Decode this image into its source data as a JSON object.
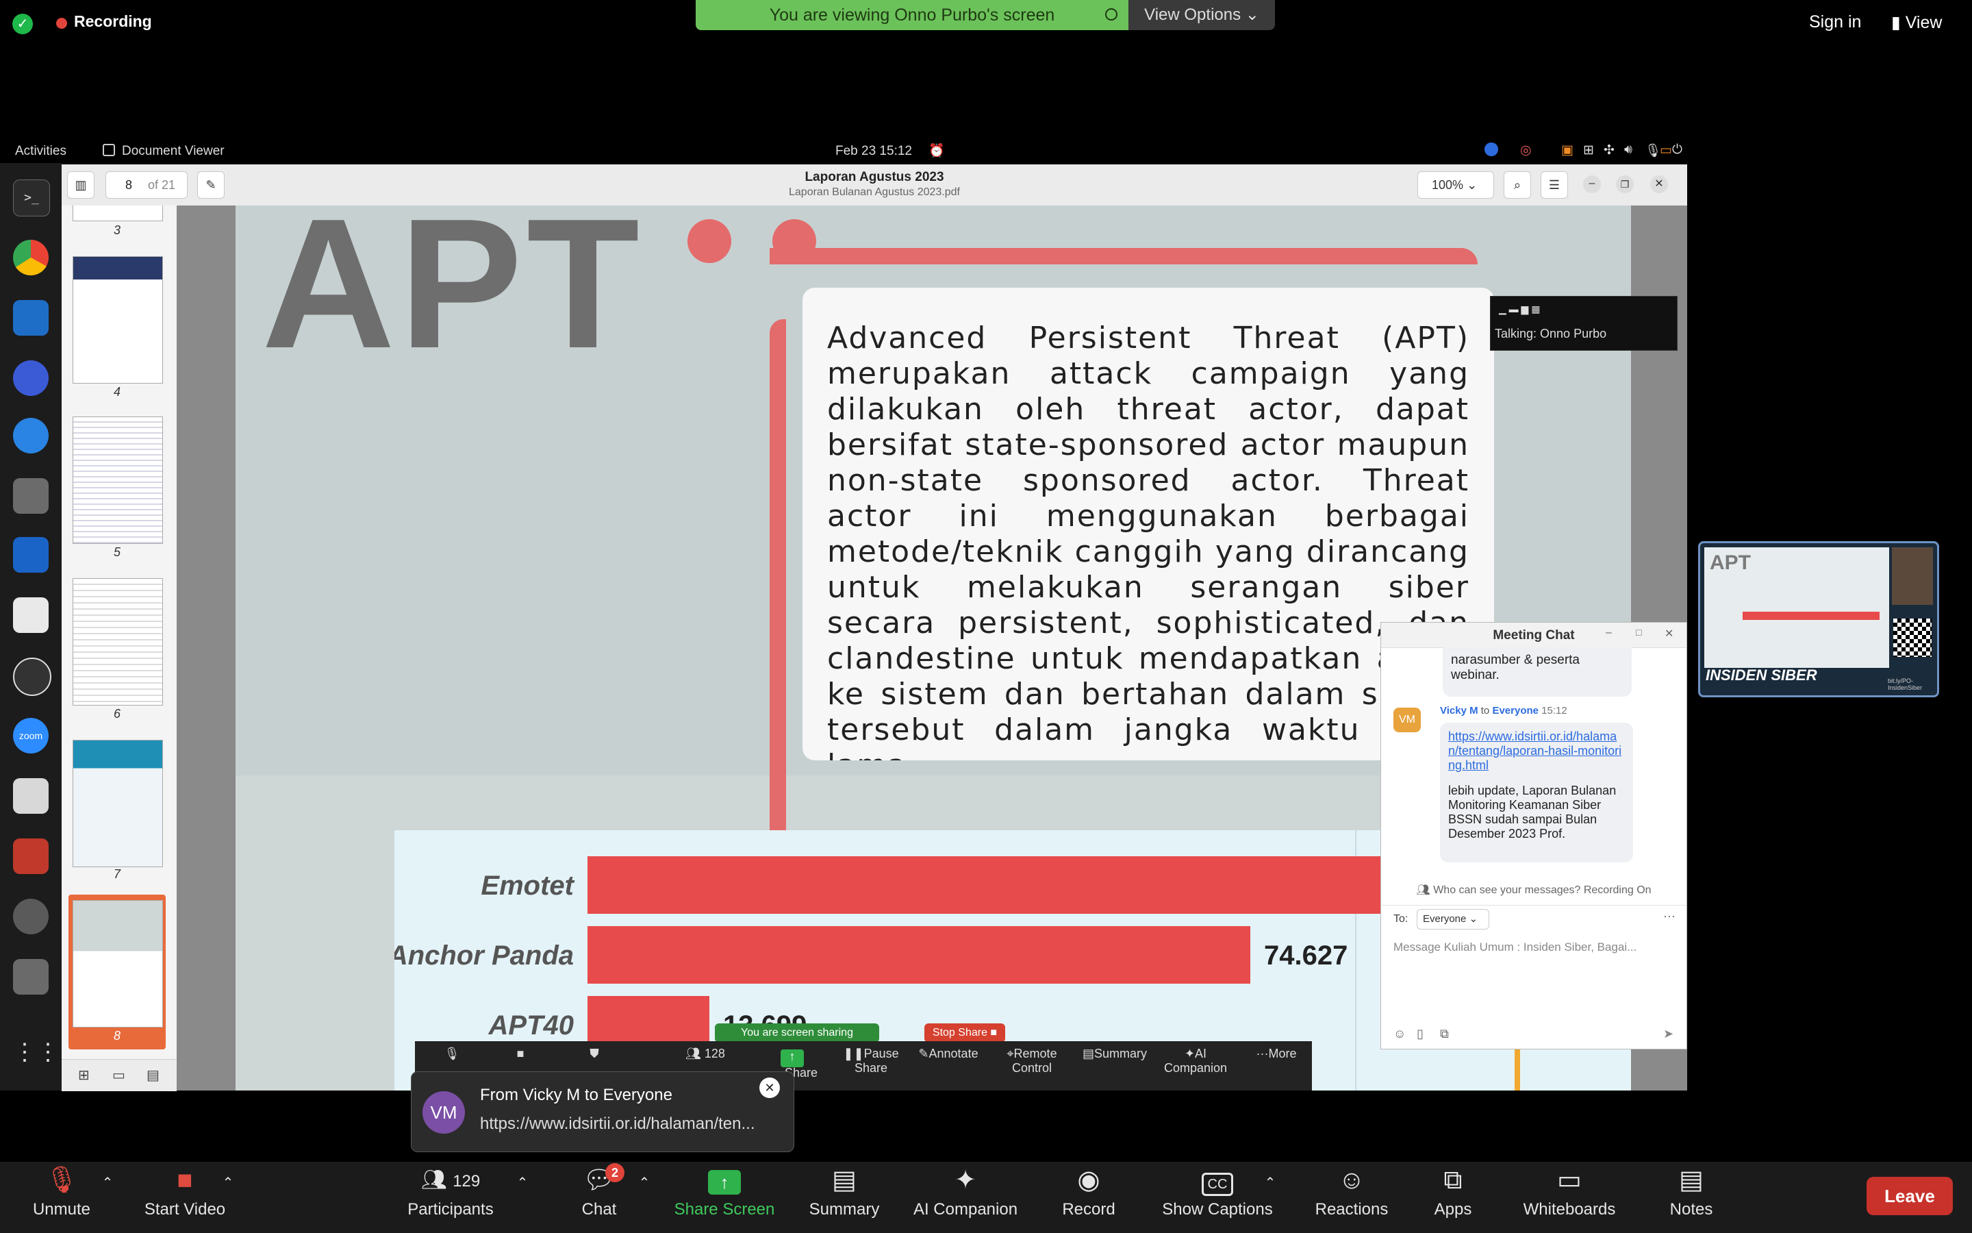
{
  "zoom_top": {
    "recording": "Recording",
    "banner": "You are viewing Onno Purbo's screen",
    "view_options": "View Options",
    "sign_in": "Sign in",
    "view": "View"
  },
  "gnome": {
    "activities": "Activities",
    "app_name": "Document Viewer",
    "datetime": "Feb 23  15:12"
  },
  "viewer": {
    "page_current": "8",
    "page_total": "of 21",
    "title": "Laporan Agustus 2023",
    "subtitle": "Laporan Bulanan Agustus 2023.pdf",
    "zoom": "100%",
    "thumbnails": [
      "3",
      "4",
      "5",
      "6",
      "7",
      "8"
    ]
  },
  "document": {
    "heading": "APT",
    "paragraph": "Advanced Persistent Threat (APT) merupakan attack campaign yang dilakukan oleh threat actor, dapat bersifat state-sponsored actor maupun non-state sponsored actor. Threat actor ini menggunakan berbagai metode/teknik canggih yang dirancang untuk melakukan serangan siber secara persistent, sophisticated, dan clandestine untuk mendapatkan akses ke sistem dan bertahan dalam sistem tersebut dalam jangka waktu yang lama.",
    "talking": "Talking: Onno Purbo"
  },
  "chart_data": {
    "type": "bar",
    "categories": [
      "Emotet",
      "Anchor Panda",
      "APT40"
    ],
    "values": [
      null,
      74.627,
      13.699
    ],
    "value_labels": [
      "",
      "74.627",
      "13.699"
    ],
    "bar_color": "#e84b4b"
  },
  "chat": {
    "title": "Meeting Chat",
    "prev_msg": "narasumber & peserta webinar.",
    "sender": "Vicky M",
    "to_word": "to",
    "recipient": "Everyone",
    "time": "15:12",
    "avatar": "VM",
    "link": "https://www.idsirtii.or.id/halaman/tentang/laporan-hasil-monitoring.html",
    "body": "lebih update, Laporan Bulanan Monitoring Keamanan Siber BSSN sudah sampai Bulan Desember 2023 Prof.",
    "visibility": "Who can see your messages? Recording On",
    "to_label": "To:",
    "to_value": "Everyone",
    "placeholder": "Message Kuliah Umum : Insiden Siber, Bagai..."
  },
  "share_strip": {
    "sharing": "You are screen sharing",
    "stop": "Stop Share",
    "participants_count": "128",
    "items": [
      "Share",
      "Pause Share",
      "Annotate",
      "Remote Control",
      "Summary",
      "AI Companion",
      "More"
    ]
  },
  "notification": {
    "avatar": "VM",
    "title": "From Vicky M to Everyone",
    "text": "https://www.idsirtii.or.id/halaman/ten..."
  },
  "toolbar": {
    "unmute": "Unmute",
    "start_video": "Start Video",
    "participants": "Participants",
    "participants_count": "129",
    "chat": "Chat",
    "chat_badge": "2",
    "share_screen": "Share Screen",
    "summary": "Summary",
    "ai_companion": "AI Companion",
    "record": "Record",
    "captions": "Show Captions",
    "reactions": "Reactions",
    "apps": "Apps",
    "whiteboards": "Whiteboards",
    "notes": "Notes",
    "leave": "Leave"
  },
  "self_view": {
    "brand": "INSIDEN SIBER",
    "handle": "bit.ly/PO-InsidenSiber"
  }
}
